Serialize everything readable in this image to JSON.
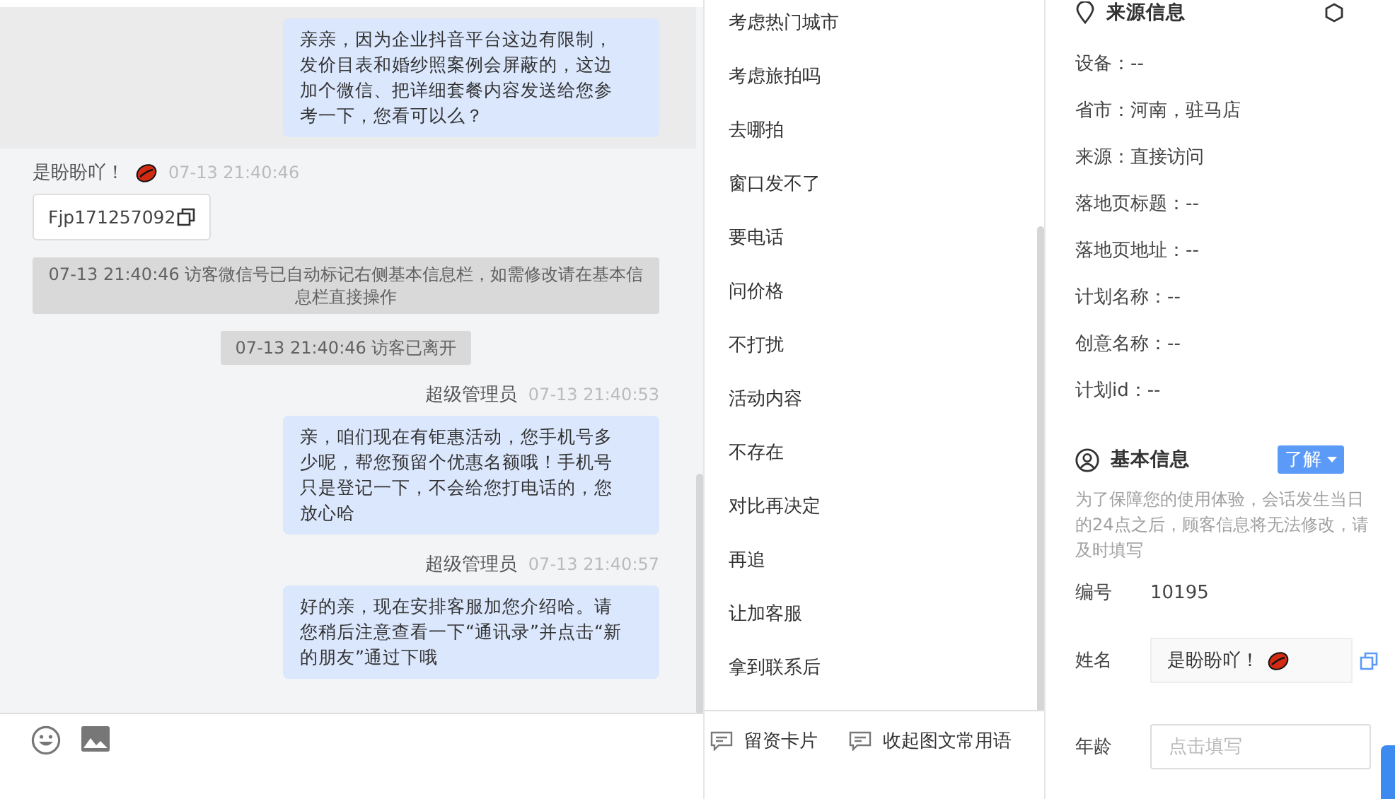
{
  "chat": {
    "messages": [
      {
        "kind": "agent",
        "highlighted": true,
        "text": "亲亲，因为企业抖音平台这边有限制，发价目表和婚纱照案例会屏蔽的，这边加个微信、把详细套餐内容发送给您参考一下，您看可以么？"
      },
      {
        "kind": "visitor",
        "highlighted": false,
        "name": "是盼盼吖！",
        "time": "07-13 21:40:46",
        "card": "Fjp171257092"
      },
      {
        "kind": "system",
        "highlighted": false,
        "text": "07-13 21:40:46 访客微信号已自动标记右侧基本信息栏，如需修改请在基本信息栏直接操作"
      },
      {
        "kind": "system",
        "highlighted": false,
        "text": "07-13 21:40:46 访客已离开"
      },
      {
        "kind": "agent",
        "highlighted": false,
        "sender": "超级管理员",
        "time": "07-13 21:40:53",
        "text": "亲，咱们现在有钜惠活动，您手机号多少呢，帮您预留个优惠名额哦！手机号只是登记一下，不会给您打电话的，您放心哈"
      },
      {
        "kind": "agent",
        "highlighted": false,
        "sender": "超级管理员",
        "time": "07-13 21:40:57",
        "text": "好的亲，现在安排客服加您介绍哈。请您稍后注意查看一下“通讯录”并点击“新的朋友”通过下哦"
      }
    ]
  },
  "quick_phrases": {
    "items": [
      "考虑热门城市",
      "考虑旅拍吗",
      "去哪拍",
      "窗口发不了",
      "要电话",
      "问价格",
      "不打扰",
      "活动内容",
      "不存在",
      "对比再决定",
      "再追",
      "让加客服",
      "拿到联系后"
    ],
    "footer": [
      "留资卡片",
      "收起图文常用语"
    ]
  },
  "source_info": {
    "title": "来源信息",
    "rows": [
      "设备：--",
      "省市：河南，驻马店",
      "来源：直接访问",
      "落地页标题：--",
      "落地页地址：--",
      "计划名称：--",
      "创意名称：--",
      "计划id：--"
    ]
  },
  "basic_info": {
    "title": "基本信息",
    "button": "了解",
    "note": "为了保障您的使用体验，会话发生当日的24点之后，顾客信息将无法修改，请及时填写",
    "fields": [
      {
        "kind": "text",
        "label": "编号",
        "value": "10195"
      },
      {
        "kind": "filled",
        "label": "姓名",
        "value": "是盼盼吖！"
      },
      {
        "kind": "input",
        "label": "年龄",
        "placeholder": "点击填写"
      }
    ]
  }
}
